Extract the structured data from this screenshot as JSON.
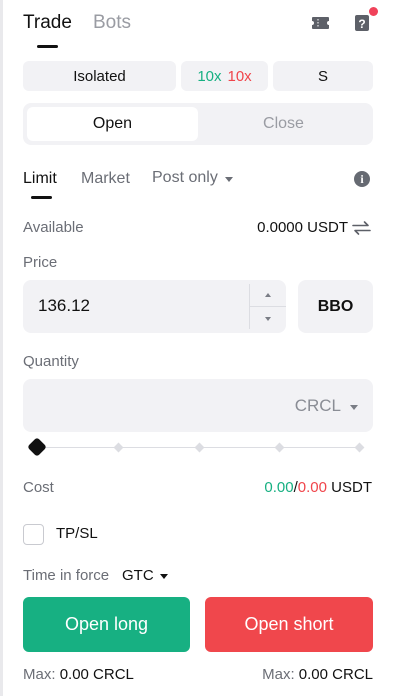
{
  "header": {
    "tabs": [
      {
        "label": "Trade",
        "active": true
      },
      {
        "label": "Bots",
        "active": false
      }
    ],
    "icons": [
      "ticket-icon",
      "help-icon"
    ],
    "notification_color": "#f0425a"
  },
  "mode": {
    "margin_label": "Isolated",
    "leverage_long": "10x",
    "leverage_short": "10x",
    "position_mode_label": "S"
  },
  "position_tabs": {
    "open_label": "Open",
    "close_label": "Close",
    "active": "Open"
  },
  "order_types": {
    "limit_label": "Limit",
    "market_label": "Market",
    "post_only_label": "Post only",
    "active": "Limit"
  },
  "available": {
    "label": "Available",
    "value": "0.0000 USDT"
  },
  "price": {
    "label": "Price",
    "value": "136.12",
    "bbo_label": "BBO"
  },
  "quantity": {
    "label": "Quantity",
    "value": "",
    "unit": "CRCL",
    "slider_percent": 0
  },
  "cost": {
    "label": "Cost",
    "long_value": "0.00",
    "separator": "/",
    "short_value": "0.00",
    "unit": "USDT"
  },
  "tpsl": {
    "label": "TP/SL",
    "checked": false
  },
  "time_in_force": {
    "label": "Time in force",
    "value": "GTC"
  },
  "actions": {
    "long_label": "Open long",
    "short_label": "Open short"
  },
  "max": {
    "long_label": "Max:",
    "long_value": "0.00 CRCL",
    "short_label": "Max:",
    "short_value": "0.00 CRCL"
  },
  "colors": {
    "long": "#17b082",
    "short": "#f0454b",
    "surface": "#f2f2f5"
  }
}
